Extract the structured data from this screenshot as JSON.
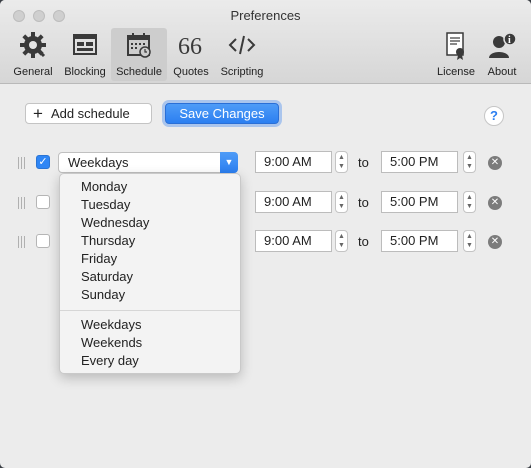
{
  "window": {
    "title": "Preferences"
  },
  "toolbar": {
    "items": [
      {
        "label": "General",
        "icon": "gear-icon"
      },
      {
        "label": "Blocking",
        "icon": "blocking-icon"
      },
      {
        "label": "Schedule",
        "icon": "calendar-icon",
        "active": true
      },
      {
        "label": "Quotes",
        "icon": "quotes-icon"
      },
      {
        "label": "Scripting",
        "icon": "code-icon"
      },
      {
        "label": "License",
        "icon": "certificate-icon"
      },
      {
        "label": "About",
        "icon": "user-info-icon"
      }
    ]
  },
  "actions": {
    "add_schedule": "Add schedule",
    "add_glyph": "+",
    "save_changes": "Save Changes",
    "help": "?"
  },
  "rows": [
    {
      "checked": true,
      "days": "Weekdays",
      "start": "9:00 AM",
      "end": "5:00 PM",
      "to": "to"
    },
    {
      "checked": false,
      "days": "",
      "start": "9:00 AM",
      "end": "5:00 PM",
      "to": "to"
    },
    {
      "checked": false,
      "days": "",
      "start": "9:00 AM",
      "end": "5:00 PM",
      "to": "to"
    }
  ],
  "dropdown": {
    "options_days": [
      "Monday",
      "Tuesday",
      "Wednesday",
      "Thursday",
      "Friday",
      "Saturday",
      "Sunday"
    ],
    "options_groups": [
      "Weekdays",
      "Weekends",
      "Every day"
    ]
  },
  "colors": {
    "accent": "#2b7ff1",
    "window_bg": "#ececec",
    "toolbar_bg": "#d6d6d6"
  }
}
